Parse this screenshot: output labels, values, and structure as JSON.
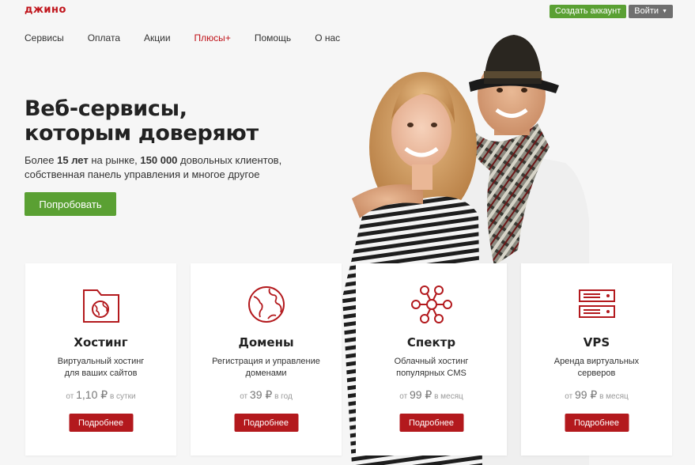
{
  "header": {
    "logo": "джино",
    "create_account": "Создать аккаунт",
    "login": "Войти"
  },
  "nav": {
    "items": [
      "Сервисы",
      "Оплата",
      "Акции",
      "Плюсы",
      "Помощь",
      "О нас"
    ],
    "plus_mark": "+"
  },
  "hero": {
    "title_line1": "Веб-сервисы,",
    "title_line2": "которым доверяют",
    "sub_part1": "Более ",
    "sub_bold1": "15 лет",
    "sub_part2": " на рынке, ",
    "sub_bold2": "150 000",
    "sub_part3": " довольных клиентов,",
    "sub_line2": "собственная панель управления и многое другое",
    "cta": "Попробовать"
  },
  "cards": [
    {
      "name": "Хостинг",
      "desc_line1": "Виртуальный хостинг",
      "desc_line2": "для ваших сайтов",
      "price_prefix": "от",
      "price_amount": "1,10 ₽",
      "price_period": "в сутки",
      "more": "Подробнее",
      "icon": "folder-globe-icon"
    },
    {
      "name": "Домены",
      "desc_line1": "Регистрация и управление",
      "desc_line2": "доменами",
      "price_prefix": "от",
      "price_amount": "39 ₽",
      "price_period": "в год",
      "more": "Подробнее",
      "icon": "globe-icon"
    },
    {
      "name": "Спектр",
      "desc_line1": "Облачный хостинг",
      "desc_line2": "популярных CMS",
      "price_prefix": "от",
      "price_amount": "99 ₽",
      "price_period": "в месяц",
      "more": "Подробнее",
      "icon": "network-nodes-icon"
    },
    {
      "name": "VPS",
      "desc_line1": "Аренда виртуальных",
      "desc_line2": "серверов",
      "price_prefix": "от",
      "price_amount": "99 ₽",
      "price_period": "в месяц",
      "more": "Подробнее",
      "icon": "server-rack-icon"
    }
  ],
  "colors": {
    "brand_red": "#c0141b",
    "button_red": "#b3191d",
    "accent_green": "#5aa033",
    "login_gray": "#6f6f6f",
    "page_bg": "#f6f6f6"
  }
}
